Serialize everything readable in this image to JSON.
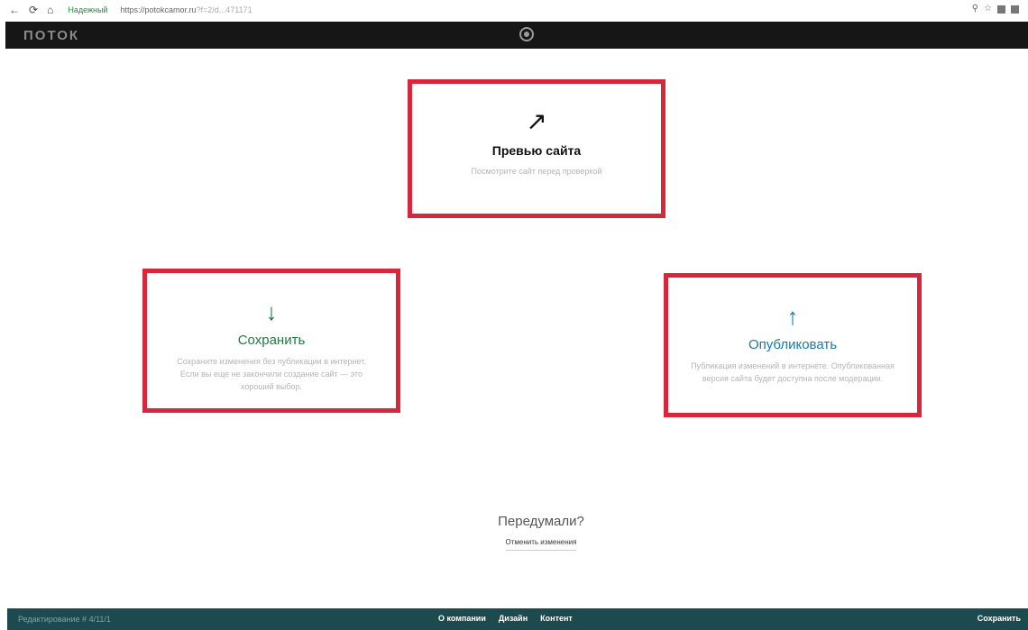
{
  "browser": {
    "back_icon": "arrow-left-icon",
    "reload_icon": "reload-icon",
    "home_icon": "home-icon",
    "secure_label": "Надежный",
    "url_host": "https://potokcamor.ru",
    "url_path": "?f=2/d...471171",
    "ext_icons": [
      "search-icon",
      "star-icon",
      "extension-icon",
      "menu-icon"
    ]
  },
  "appbar": {
    "logo": "ПОТОК",
    "center_icon": "record-icon"
  },
  "cards": {
    "preview": {
      "icon": "↗",
      "title": "Превью сайта",
      "desc": "Посмотрите сайт перед проверкой"
    },
    "save": {
      "icon": "↓",
      "title": "Сохранить",
      "desc": "Сохраните изменения без публикации в интернет. Если вы еще не закончили создание сайт — это хороший выбор."
    },
    "publish": {
      "icon": "↑",
      "title": "Опубликовать",
      "desc": "Публикация изменений в интернете. Опубликованная версия сайта будет доступна после модерации."
    }
  },
  "changed_mind": {
    "question": "Передумали?",
    "revert_label": "Отменить изменения"
  },
  "bottombar": {
    "edited": "Редактирование # 4/11/1",
    "links": [
      "О компании",
      "Дизайн",
      "Контент"
    ],
    "save_label": "Сохранить"
  },
  "colors": {
    "card_border": "#d8263d",
    "save_green": "#1e7a3a",
    "publish_blue": "#1a7aa8",
    "bottom_bar": "#1c4a4f"
  }
}
